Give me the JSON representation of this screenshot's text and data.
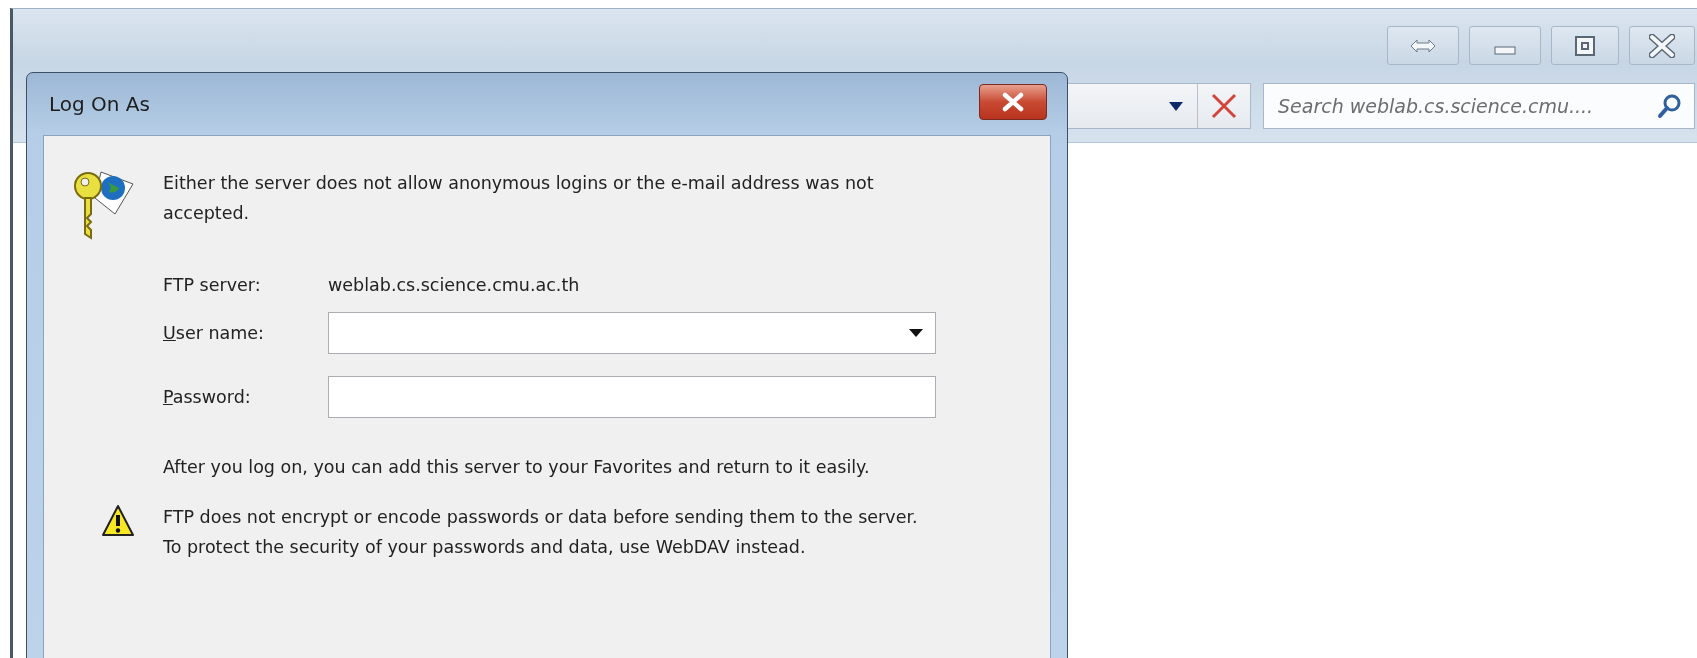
{
  "explorer": {
    "caption_buttons": [
      {
        "kind": "swap"
      },
      {
        "kind": "minimize"
      },
      {
        "kind": "maximize"
      },
      {
        "kind": "close"
      }
    ],
    "search": {
      "placeholder": "Search weblab.cs.science.cmu...."
    }
  },
  "dialog": {
    "title": "Log On As",
    "message": "Either the server does not allow anonymous logins or the e-mail address was not accepted.",
    "server_label": "FTP server:",
    "server_value": "weblab.cs.science.cmu.ac.th",
    "user_label": "User name:",
    "password_label": "Password:",
    "favorites_note": "After you log on, you can add this server to your Favorites and return to it easily.",
    "warning": "FTP does not encrypt or encode passwords or data before sending them to the server.  To protect the security of your passwords and data, use WebDAV instead."
  }
}
